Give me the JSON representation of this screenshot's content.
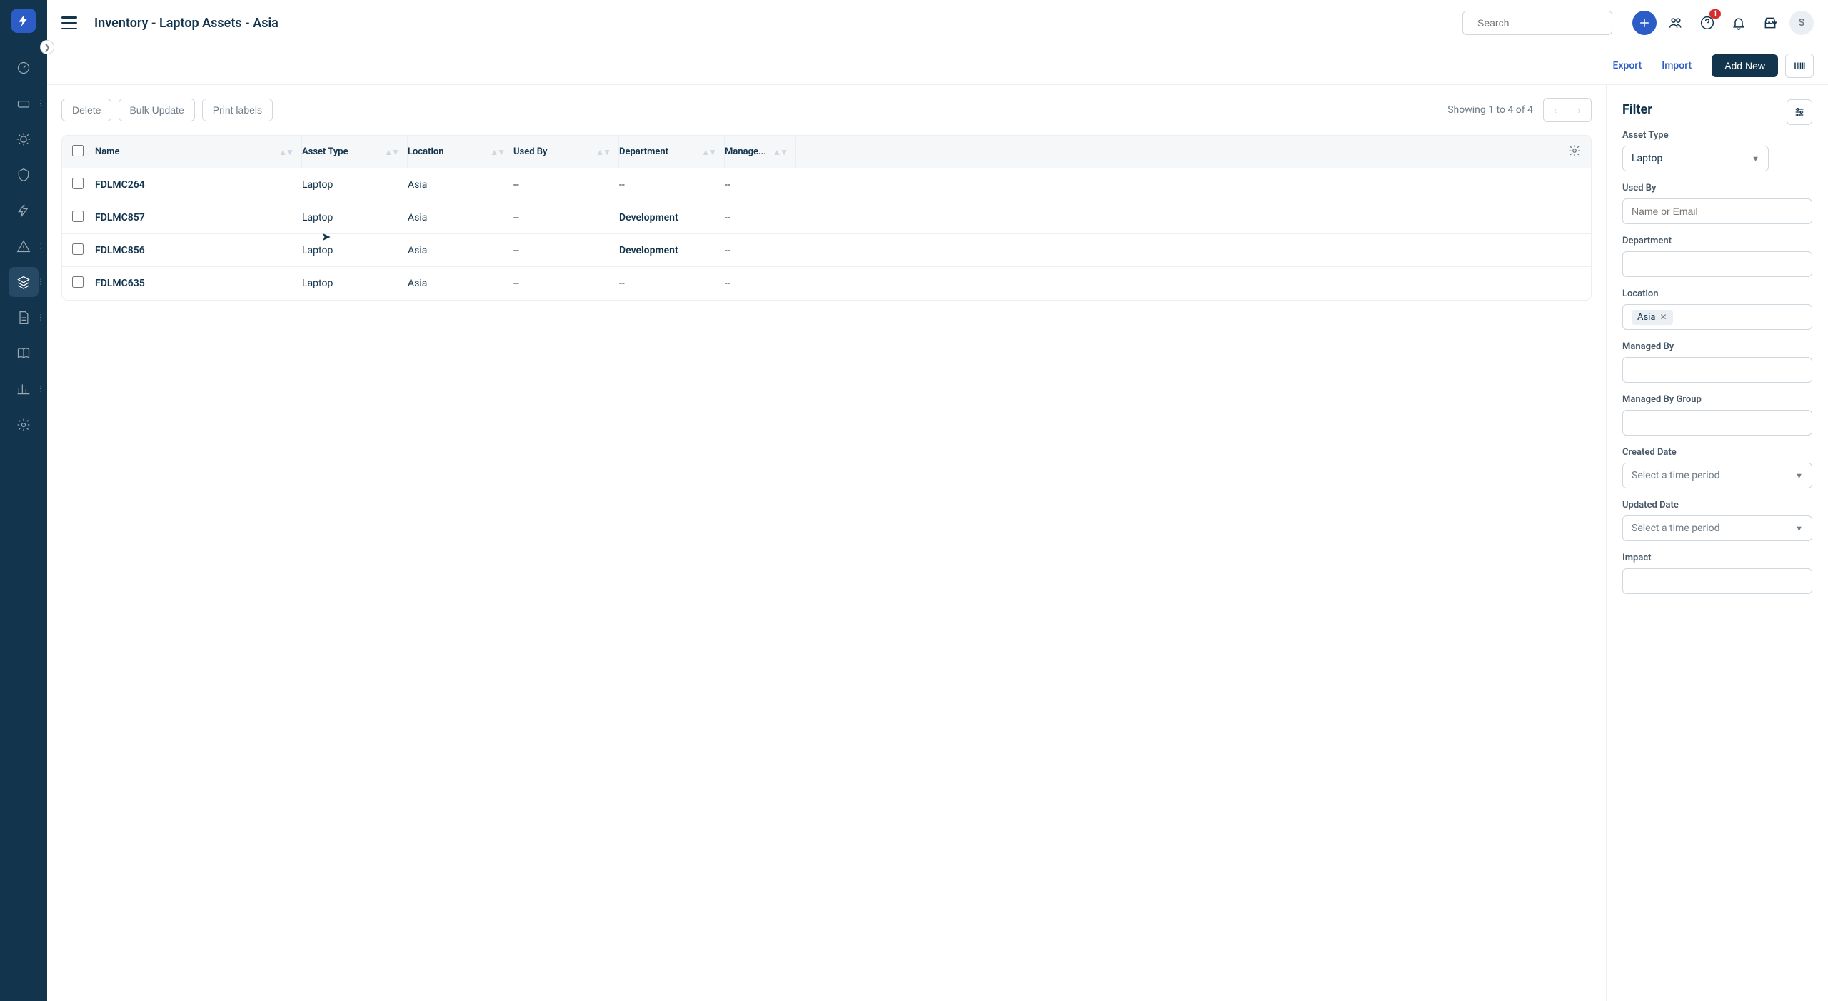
{
  "header": {
    "title": "Inventory - Laptop Assets - Asia",
    "search_placeholder": "Search",
    "notif_badge": "1",
    "avatar": "S"
  },
  "toolbar": {
    "export": "Export",
    "import": "Import",
    "add_new": "Add New"
  },
  "actions": {
    "delete": "Delete",
    "bulk": "Bulk Update",
    "print": "Print labels",
    "showing": "Showing 1 to 4 of 4"
  },
  "columns": {
    "name": "Name",
    "asset_type": "Asset Type",
    "location": "Location",
    "used_by": "Used By",
    "department": "Department",
    "managed": "Manage..."
  },
  "rows": [
    {
      "name": "FDLMC264",
      "type": "Laptop",
      "loc": "Asia",
      "used": "--",
      "dept": "--",
      "mgr": "--"
    },
    {
      "name": "FDLMC857",
      "type": "Laptop",
      "loc": "Asia",
      "used": "--",
      "dept": "Development",
      "mgr": "--"
    },
    {
      "name": "FDLMC856",
      "type": "Laptop",
      "loc": "Asia",
      "used": "--",
      "dept": "Development",
      "mgr": "--"
    },
    {
      "name": "FDLMC635",
      "type": "Laptop",
      "loc": "Asia",
      "used": "--",
      "dept": "--",
      "mgr": "--"
    }
  ],
  "filter": {
    "title": "Filter",
    "asset_type_label": "Asset Type",
    "asset_type_value": "Laptop",
    "used_by_label": "Used By",
    "used_by_placeholder": "Name or Email",
    "department_label": "Department",
    "location_label": "Location",
    "location_chip": "Asia",
    "managed_by_label": "Managed By",
    "managed_by_group_label": "Managed By Group",
    "created_label": "Created Date",
    "created_placeholder": "Select a time period",
    "updated_label": "Updated Date",
    "updated_placeholder": "Select a time period",
    "impact_label": "Impact"
  }
}
